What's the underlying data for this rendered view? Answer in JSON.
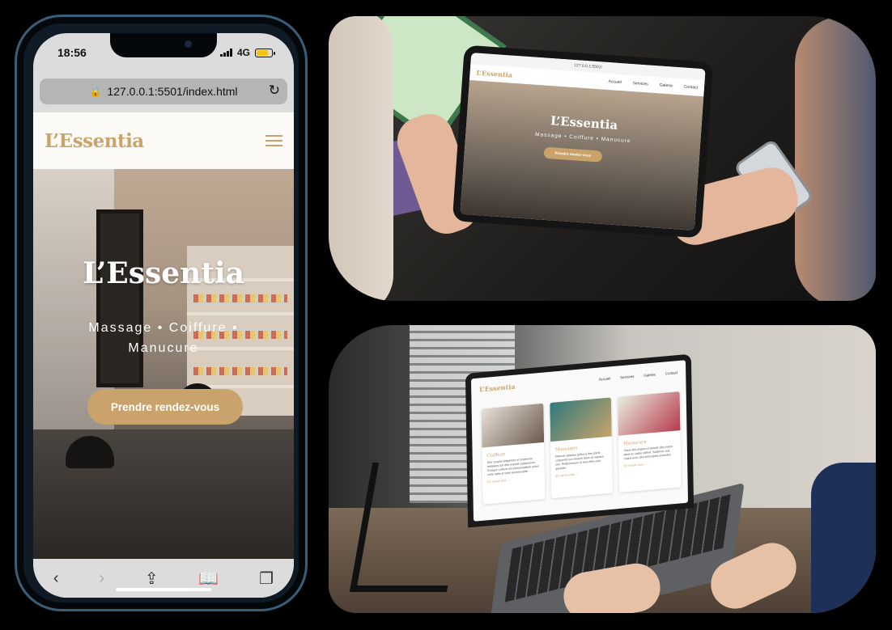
{
  "phone": {
    "status": {
      "time": "18:56",
      "network": "4G"
    },
    "url": "127.0.0.1:5501/index.html",
    "brand": "L’Essentia",
    "hero": {
      "title": "L’Essentia",
      "subtitle": "Massage • Coiffure • Manucure",
      "cta": "Prendre rendez-vous"
    },
    "toolbar_icons": [
      "back-icon",
      "forward-icon",
      "share-icon",
      "bookmarks-icon",
      "tabs-icon"
    ]
  },
  "tablet": {
    "url": "127.0.0.1:5501/",
    "brand": "L’Essentia",
    "nav": [
      "Accueil",
      "Services",
      "Galerie",
      "Contact"
    ],
    "hero": {
      "title": "L’Essentia",
      "subtitle": "Massage • Coiffure • Manucure",
      "cta": "Prendre rendez-vous"
    }
  },
  "laptop": {
    "brand": "L’Essentia",
    "nav": [
      "Accueil",
      "Services",
      "Galerie",
      "Contact"
    ],
    "cards": [
      {
        "title": "Coiffure",
        "text": "Des coupes élégantes et modernes réalisées par des experts passionnés. Chaque coiffure est personnalisée selon votre style et votre personnalité.",
        "link": "En savoir plus →"
      },
      {
        "title": "Massages",
        "text": "Détente absolue grâce à des soins corporels sur mesure dans un espace zen. Relâchement et bien-être sont garantis.",
        "link": "En savoir plus →"
      },
      {
        "title": "Manucure",
        "text": "Soins des ongles et beauté des mains dans un cadre raffiné. Sublimez vos mains avec des techniques expertes.",
        "link": "En savoir plus →"
      }
    ]
  },
  "colors": {
    "accent": "#c9a36b",
    "background": "#000000"
  }
}
